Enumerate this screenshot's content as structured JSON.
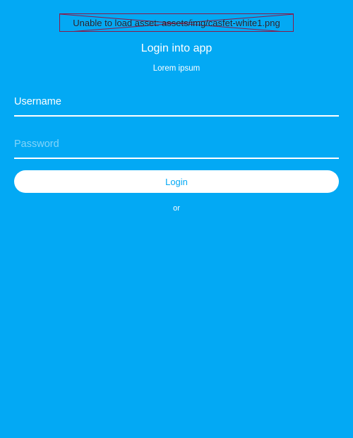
{
  "asset_error": {
    "message": "Unable to load asset: assets/img/casfet-white1.png",
    "border_color": "#8a1a4a"
  },
  "header": {
    "title": "Login into app",
    "subtitle": "Lorem ipsum"
  },
  "form": {
    "username_placeholder": "Username",
    "username_value": "",
    "password_placeholder": "Password",
    "password_value": "",
    "login_label": "Login",
    "or_label": "or"
  },
  "colors": {
    "background": "#03A9F4",
    "foreground": "#FFFFFF",
    "button_text": "#03A9F4"
  }
}
